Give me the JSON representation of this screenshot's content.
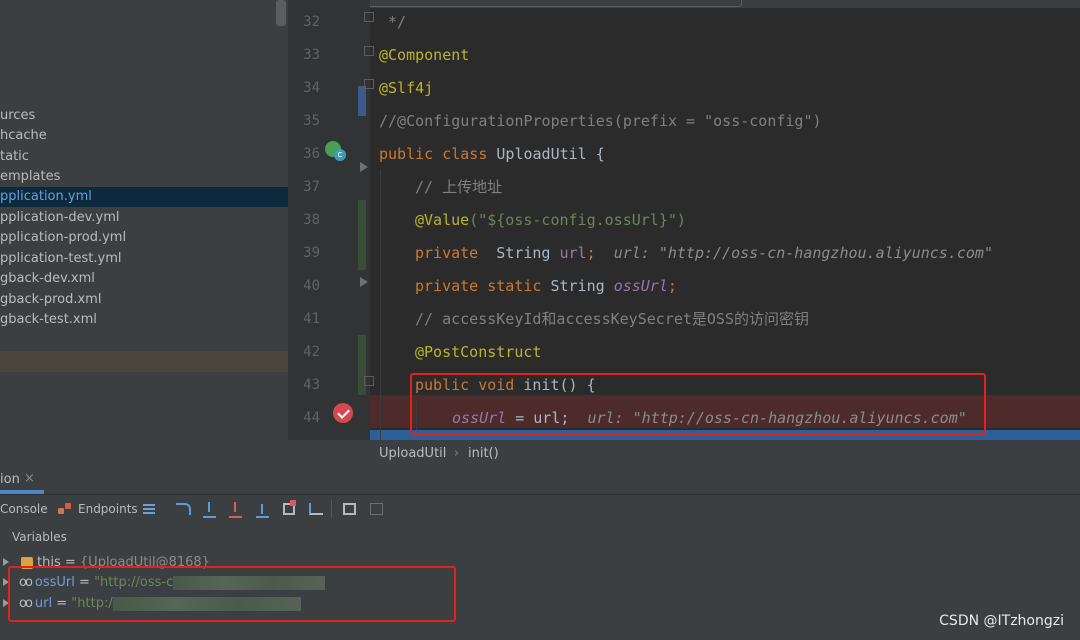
{
  "project_tree": {
    "items": [
      {
        "label": "urces"
      },
      {
        "label": "hcache"
      },
      {
        "label": "tatic"
      },
      {
        "label": "emplates"
      },
      {
        "label": "pplication.yml"
      },
      {
        "label": "pplication-dev.yml"
      },
      {
        "label": "pplication-prod.yml"
      },
      {
        "label": "pplication-test.yml"
      },
      {
        "label": "gback-dev.xml"
      },
      {
        "label": "gback-prod.xml"
      },
      {
        "label": "gback-test.xml"
      }
    ]
  },
  "editor": {
    "lines": [
      {
        "num": "32"
      },
      {
        "num": "33"
      },
      {
        "num": "34"
      },
      {
        "num": "35"
      },
      {
        "num": "36"
      },
      {
        "num": "37"
      },
      {
        "num": "38"
      },
      {
        "num": "39"
      },
      {
        "num": "40"
      },
      {
        "num": "41"
      },
      {
        "num": "42"
      },
      {
        "num": "43"
      },
      {
        "num": "44"
      }
    ],
    "code": {
      "l32": " */",
      "l33": "@Component",
      "l34": "@Slf4j",
      "l35": "//@ConfigurationProperties(prefix = \"oss-config\")",
      "l36_kw": "public class ",
      "l36_name": "UploadUtil {",
      "l37": "// 上传地址",
      "l38_ann": "@Value",
      "l38_str": "(\"${oss-config.ossUrl}\")",
      "l39_kw": "private  ",
      "l39_type": "String ",
      "l39_fld": "url",
      "l39_semi": ";  ",
      "l39_hint": "url: \"http://oss-cn-hangzhou.aliyuncs.com\"",
      "l40_kw": "private static ",
      "l40_type": "String ",
      "l40_fld": "ossUrl",
      "l40_semi": ";",
      "l41": "// accessKeyId和accessKeySecret是OSS的访问密钥",
      "l42": "@PostConstruct",
      "l43_kw": "public void ",
      "l43_name": "init() {",
      "l44_fld": "ossUrl",
      "l44_rest": " = url;  ",
      "l44_hint": "url: \"http://oss-cn-hangzhou.aliyuncs.com\""
    }
  },
  "breadcrumb": {
    "class_name": "UploadUtil",
    "separator": "›",
    "method_name": "init()"
  },
  "debug": {
    "tab_title": "ion",
    "tab_close": "×",
    "console_label": "Console",
    "endpoints_label": "Endpoints",
    "variables_label": "Variables",
    "vars": [
      {
        "name": "this",
        "value": "{UploadUtil@8168}"
      },
      {
        "name": "ossUrl",
        "value": "\"http://oss-c"
      },
      {
        "name": "url",
        "value": "\"http:/"
      }
    ]
  },
  "watermark": "CSDN @ITzhongzi",
  "colors": {
    "keyword": "#cc7832",
    "annotation": "#bbb529",
    "string": "#6a8759",
    "comment": "#808080",
    "field": "#9876aa",
    "highlight_box": "#e0231f"
  }
}
